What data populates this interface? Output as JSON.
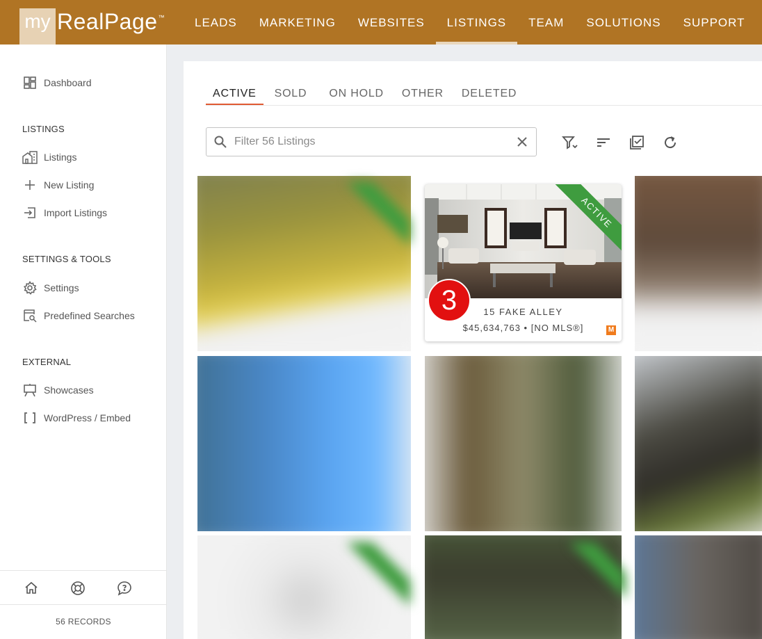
{
  "brand": {
    "my": "my",
    "name": "RealPage",
    "tm": "™"
  },
  "nav": [
    "LEADS",
    "MARKETING",
    "WEBSITES",
    "LISTINGS",
    "TEAM",
    "SOLUTIONS",
    "SUPPORT"
  ],
  "nav_active": "LISTINGS",
  "sidebar": {
    "dashboard": "Dashboard",
    "listings_heading": "LISTINGS",
    "listings": "Listings",
    "new_listing": "New Listing",
    "import_listings": "Import Listings",
    "settings_heading": "SETTINGS & TOOLS",
    "settings": "Settings",
    "predefined_searches": "Predefined Searches",
    "external_heading": "EXTERNAL",
    "showcases": "Showcases",
    "wordpress": "WordPress / Embed",
    "records": "56 RECORDS"
  },
  "tabs": [
    "ACTIVE",
    "SOLD",
    "ON HOLD",
    "OTHER",
    "DELETED"
  ],
  "tab_active": "ACTIVE",
  "search": {
    "placeholder": "Filter 56 Listings",
    "value": ""
  },
  "card": {
    "status": "ACTIVE",
    "badge": "3",
    "address": "15 FAKE ALLEY",
    "price_line": "$45,634,763 • [NO MLS®]",
    "mls_logo": "M"
  },
  "colors": {
    "topbar": "#b07424",
    "accent": "#e05a32",
    "active_ribbon": "#3f9c3f",
    "badge": "#e21010"
  }
}
